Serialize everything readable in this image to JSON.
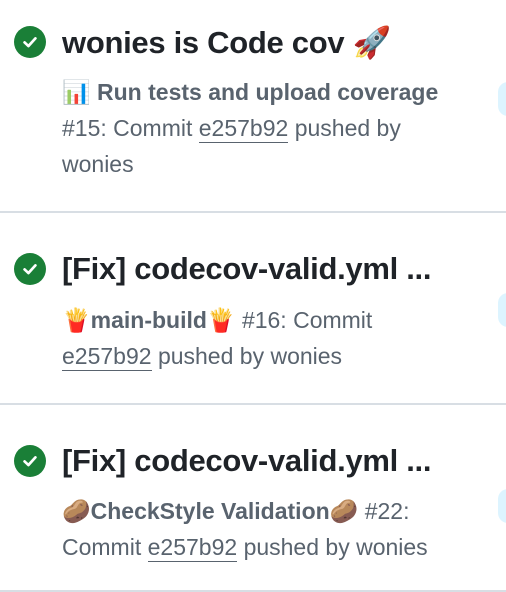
{
  "runs": [
    {
      "title": "wonies is Code cov 🚀",
      "workflow": "📊 Run tests and upload coverage",
      "run_number": "#15: Commit",
      "commit": "e257b92",
      "pushed_by": "pushed by wonies",
      "status": "success"
    },
    {
      "title": "[Fix] codecov-valid.yml ...",
      "workflow": "🍟main-build🍟",
      "run_number": "#16: Commit",
      "commit": "e257b92",
      "pushed_by": "pushed by wonies",
      "status": "success"
    },
    {
      "title": "[Fix] codecov-valid.yml ...",
      "workflow": "🥔CheckStyle Validation🥔",
      "run_number": "#22:",
      "run_number_cont": "Commit",
      "commit": "e257b92",
      "pushed_by": "pushed by wonies",
      "status": "success"
    }
  ],
  "icons": {
    "status": "check-circle-icon"
  },
  "colors": {
    "success": "#1a7f37",
    "muted_text": "#59636e",
    "title_text": "#1f2328",
    "divider": "#d8dee4",
    "badge_bg": "#ddf4ff"
  }
}
